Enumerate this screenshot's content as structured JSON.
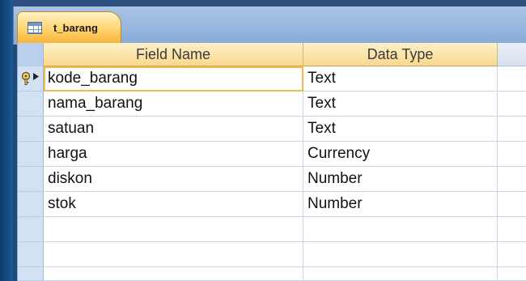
{
  "tab": {
    "label": "t_barang",
    "icon": "table-icon"
  },
  "columns": {
    "field_name": "Field Name",
    "data_type": "Data Type"
  },
  "rows": [
    {
      "field_name": "kode_barang",
      "data_type": "Text",
      "primary_key": true
    },
    {
      "field_name": "nama_barang",
      "data_type": "Text"
    },
    {
      "field_name": "satuan",
      "data_type": "Text"
    },
    {
      "field_name": "harga",
      "data_type": "Currency"
    },
    {
      "field_name": "diskon",
      "data_type": "Number"
    },
    {
      "field_name": "stok",
      "data_type": "Number"
    },
    {
      "field_name": "",
      "data_type": ""
    },
    {
      "field_name": "",
      "data_type": ""
    },
    {
      "field_name": "",
      "data_type": ""
    }
  ],
  "colors": {
    "tab_active": "#ffd56f",
    "header": "#fad88e",
    "selector": "#d2e2f4",
    "active_outline": "#f2b94c"
  }
}
